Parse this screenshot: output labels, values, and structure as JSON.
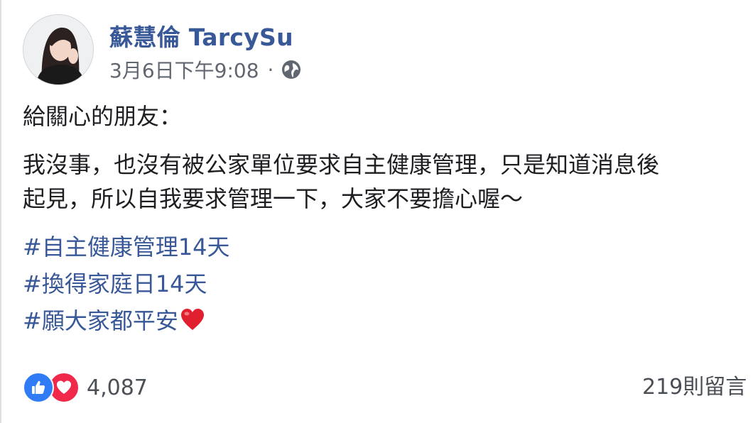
{
  "post": {
    "author": "蘇慧倫 TarcySu",
    "timestamp": "3月6日下午9:08",
    "separator": "·",
    "privacy_icon": "globe-icon",
    "greeting": "給關心的朋友：",
    "body_line_1": "我沒事，也沒有被公家單位要求自主健康管理，只是知道消息後",
    "body_line_2": "起見，所以自我要求管理一下，大家不要擔心喔～",
    "hashtags": [
      "#自主健康管理14天",
      "#換得家庭日14天",
      "#願大家都平安"
    ],
    "hashtag_emoji": "red-heart-icon"
  },
  "reactions": {
    "icons": [
      "like-icon",
      "love-icon"
    ],
    "count": "4,087"
  },
  "comments": {
    "label": "219則留言"
  },
  "colors": {
    "link": "#385898",
    "text": "#1c1e21",
    "meta": "#616770",
    "like": "#2f7cf6",
    "love": "#f0284a"
  }
}
